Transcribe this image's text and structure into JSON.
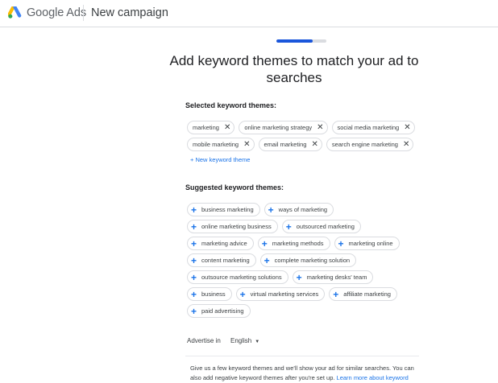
{
  "header": {
    "brand": "Google Ads",
    "page_title": "New campaign"
  },
  "progress": {
    "percent": 72
  },
  "heading": "Add keyword themes to match your ad to searches",
  "selected": {
    "title": "Selected keyword themes:",
    "rows": [
      [
        "marketing",
        "online marketing strategy",
        "social media marketing"
      ],
      [
        "mobile marketing",
        "email marketing",
        "search engine marketing"
      ]
    ],
    "new_theme_label": "+ New keyword theme"
  },
  "suggested": {
    "title": "Suggested keyword themes:",
    "rows": [
      [
        "business marketing",
        "ways of marketing"
      ],
      [
        "online marketing business",
        "outsourced marketing"
      ],
      [
        "marketing advice",
        "marketing methods",
        "marketing online"
      ],
      [
        "content marketing",
        "complete marketing solution"
      ],
      [
        "outsource marketing solutions",
        "marketing desks' team"
      ],
      [
        "business",
        "virtual marketing services",
        "affiliate marketing"
      ],
      [
        "paid advertising"
      ]
    ]
  },
  "advertise": {
    "label": "Advertise in",
    "language": "English"
  },
  "info": {
    "text": "Give us a few keyword themes and we'll show your ad for similar searches. You can also add negative keyword themes after you're set up.",
    "link": "Learn more about keyword"
  },
  "colors": {
    "accent": "#1a73e8",
    "progress": "#1a56db",
    "border": "#dadce0"
  }
}
